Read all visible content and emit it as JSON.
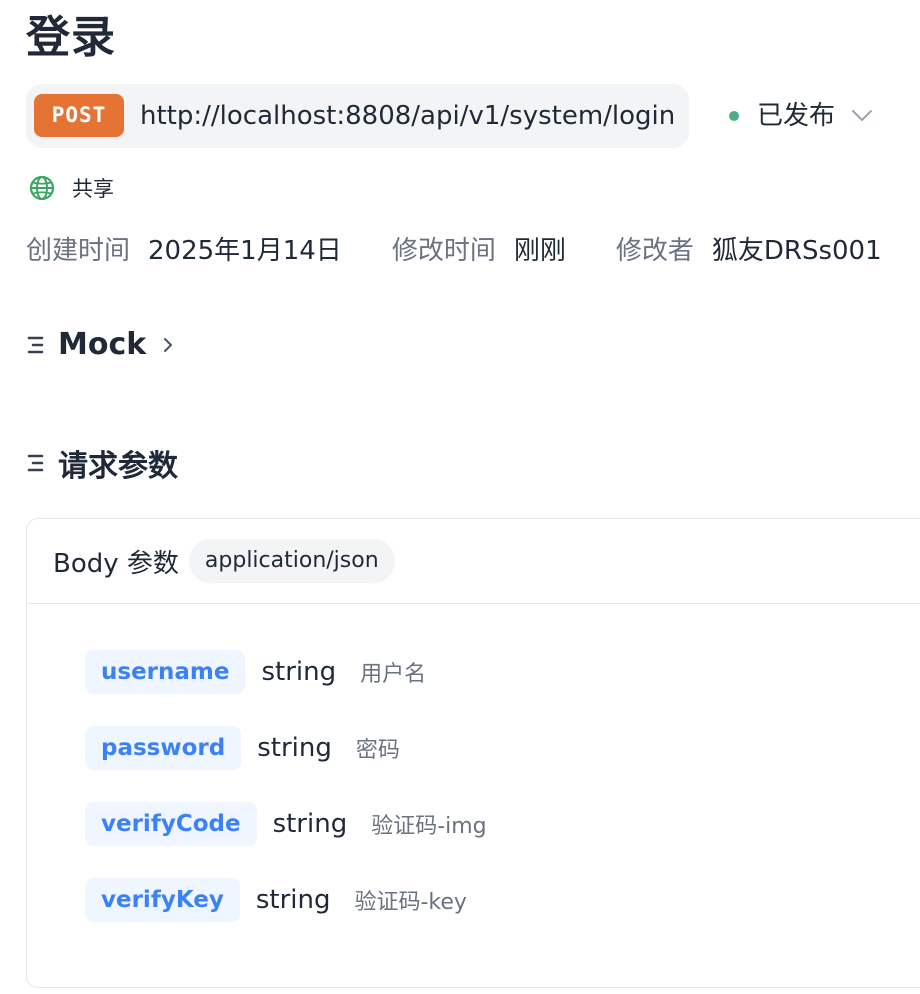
{
  "endpoint": {
    "title": "登录",
    "method": "POST",
    "url": "http://localhost:8808/api/v1/system/login",
    "status": "已发布",
    "status_color": "#4caf83",
    "share_label": "共享",
    "share_icon": "globe-icon"
  },
  "meta": {
    "created_label": "创建时间",
    "created_value": "2025年1月14日",
    "modified_label": "修改时间",
    "modified_value": "刚刚",
    "modifier_label": "修改者",
    "modifier_value": "狐友DRSs001"
  },
  "sections": {
    "mock_title": "Mock",
    "request_title": "请求参数"
  },
  "body": {
    "title": "Body 参数",
    "content_type": "application/json",
    "params": [
      {
        "name": "username",
        "type": "string",
        "desc": "用户名"
      },
      {
        "name": "password",
        "type": "string",
        "desc": "密码"
      },
      {
        "name": "verifyCode",
        "type": "string",
        "desc": "验证码-img"
      },
      {
        "name": "verifyKey",
        "type": "string",
        "desc": "验证码-key"
      }
    ]
  },
  "colors": {
    "method_bg": "#e57434",
    "param_name_color": "#3b82f6",
    "param_name_bg": "#f0f6ff"
  }
}
